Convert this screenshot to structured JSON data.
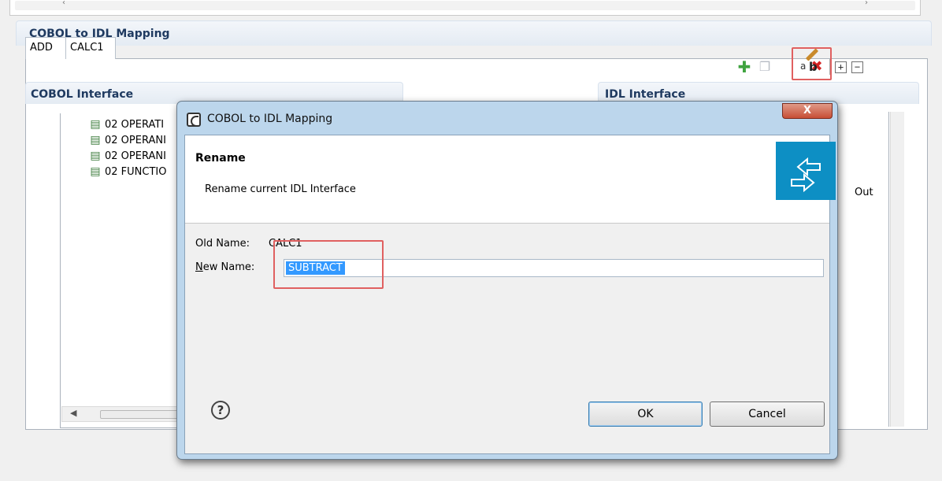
{
  "section": {
    "title": "COBOL to IDL Mapping"
  },
  "tabs": [
    {
      "label": "ADD"
    },
    {
      "label": "CALC1"
    }
  ],
  "cobol_interface": {
    "title": "COBOL Interface",
    "items": [
      "02 OPERATI",
      "02 OPERANI",
      "02 OPERANI",
      "02 FUNCTIO"
    ]
  },
  "idl_interface": {
    "title": "IDL Interface",
    "out_label": "Out"
  },
  "dialog": {
    "title": "COBOL to IDL Mapping",
    "close_label": "X",
    "banner_title": "Rename",
    "banner_desc": "Rename current IDL Interface",
    "old_name_label": "Old Name:",
    "old_name_value": "CALC1",
    "new_name_label_u": "N",
    "new_name_label_rest": "ew Name:",
    "new_name_value": "SUBTRACT",
    "ok_label": "OK",
    "cancel_label": "Cancel"
  }
}
